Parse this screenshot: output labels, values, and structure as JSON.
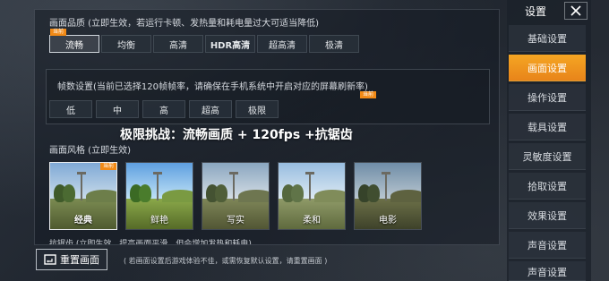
{
  "quality": {
    "title": "画面品质 (立即生效，若运行卡顿、发热量和耗电量过大可适当降低)",
    "options": [
      "流畅",
      "均衡",
      "高清",
      "HDR高清",
      "超高清",
      "极清"
    ],
    "selected": "流畅",
    "current_tag": "当前"
  },
  "fps": {
    "title": "帧数设置(当前已选择120帧帧率，请确保在手机系统中开启对应的屏幕刷新率)",
    "options": [
      "低",
      "中",
      "高",
      "超高",
      "极限"
    ],
    "tag": "当前"
  },
  "challenge": {
    "text": "极限挑战：流畅画质 + 120fps +抗锯齿"
  },
  "style": {
    "title": "画面风格 (立即生效)",
    "options": [
      "经典",
      "鲜艳",
      "写实",
      "柔和",
      "电影"
    ],
    "selected": "经典",
    "current_tag": "当前"
  },
  "antialias": {
    "text": "抗锯齿 (立即生效，提高画面平滑，但会增加发热和耗电)"
  },
  "bottom": {
    "reset_label": "重置画面",
    "note": "( 若画面设置后游戏体验不佳，或需恢复默认设置，请重置画面 )"
  },
  "sidebar": {
    "title": "设置",
    "items": [
      "基础设置",
      "画面设置",
      "操作设置",
      "载具设置",
      "灵敏度设置",
      "拾取设置",
      "效果设置",
      "声音设置",
      "声音设置"
    ],
    "active": "画面设置"
  },
  "colors": {
    "accent": "#f5a623",
    "tag": "#f28a16"
  }
}
